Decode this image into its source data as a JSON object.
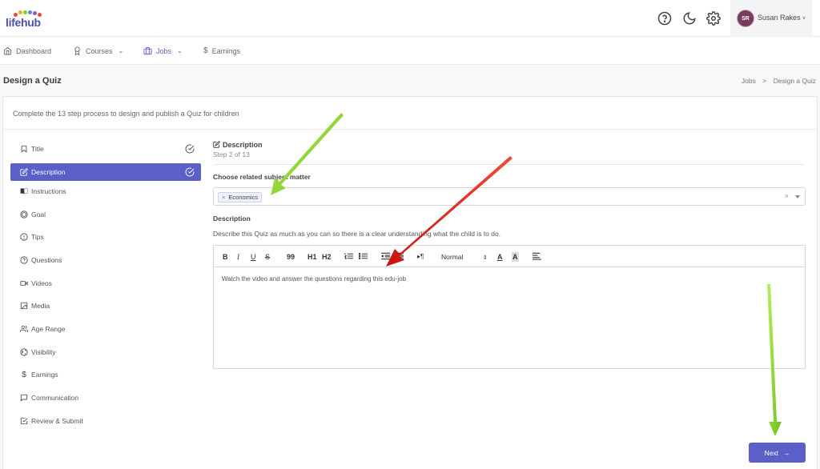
{
  "app": {
    "logo_text": "lifehub",
    "user_initials": "SR",
    "user_name": "Susan Rakes"
  },
  "nav": [
    {
      "label": "Dashboard",
      "icon": "home-icon"
    },
    {
      "label": "Courses",
      "icon": "award-icon"
    },
    {
      "label": "Jobs",
      "icon": "briefcase-icon",
      "active": true
    },
    {
      "label": "Earnings",
      "icon": "dollar-icon"
    }
  ],
  "page": {
    "title": "Design a Quiz",
    "breadcrumb_parent": "Jobs",
    "breadcrumb_separator": ">",
    "breadcrumb_current": "Design a Quiz",
    "intro": "Complete the 13 step process to design and publish a Quiz for children"
  },
  "steps": [
    {
      "label": "Title",
      "icon": "bookmark-icon",
      "done": true
    },
    {
      "label": "Description",
      "icon": "edit-icon",
      "done": true,
      "active": true
    },
    {
      "label": "Instructions",
      "icon": "book-icon"
    },
    {
      "label": "Goal",
      "icon": "target-icon"
    },
    {
      "label": "Tips",
      "icon": "alert-circle-icon"
    },
    {
      "label": "Questions",
      "icon": "help-circle-icon"
    },
    {
      "label": "Videos",
      "icon": "video-icon"
    },
    {
      "label": "Media",
      "icon": "image-icon"
    },
    {
      "label": "Age Range",
      "icon": "users-icon"
    },
    {
      "label": "Visibility",
      "icon": "globe-icon"
    },
    {
      "label": "Earnings",
      "icon": "dollar-icon"
    },
    {
      "label": "Communication",
      "icon": "message-icon"
    },
    {
      "label": "Review & Submit",
      "icon": "check-square-icon"
    }
  ],
  "form": {
    "section_title": "Description",
    "step_text": "Step 2 of 13",
    "subject_label": "Choose related subject matter",
    "subject_tag": "Economics",
    "subject_tag_remove": "×",
    "subject_clear": "×",
    "description_label": "Description",
    "description_hint": "Describe this Quiz as much as you can so there is a clear understanding what the child is to do.",
    "editor_text": "Watch the video and answer the questions regarding this edu-job",
    "editor_format": "Normal"
  },
  "toolbar": {
    "bold": "B",
    "italic": "I",
    "underline": "U",
    "strike": "S",
    "quote": "99",
    "h1": "H1",
    "h2": "H2",
    "rtl": "▸¶"
  },
  "buttons": {
    "next": "Next",
    "next_arrow": "→"
  },
  "colors": {
    "accent": "#5b5fc7",
    "arrow_green": "#8dd13a",
    "arrow_red": "#e3261c"
  }
}
